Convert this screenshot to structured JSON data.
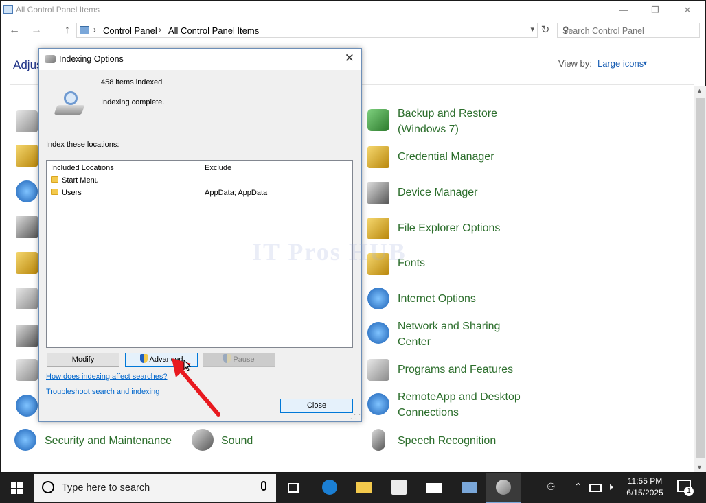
{
  "window": {
    "title": "All Control Panel Items",
    "minimize": "—",
    "maximize": "❐",
    "close": "✕",
    "nav": {
      "back": "←",
      "forward": "→",
      "up": "↑"
    },
    "breadcrumb": [
      "Control Panel",
      "All Control Panel Items"
    ],
    "breadcrumb_sep": "›",
    "search_placeholder": "Search Control Panel",
    "heading_partial": "Adjus",
    "view_by_label": "View by:",
    "view_by_value": "Large icons"
  },
  "items_right": [
    {
      "label": "Backup and Restore (Windows 7)",
      "icon": "backup-icon"
    },
    {
      "label": "Credential Manager",
      "icon": "credential-icon"
    },
    {
      "label": "Device Manager",
      "icon": "device-manager-icon"
    },
    {
      "label": "File Explorer Options",
      "icon": "folder-options-icon"
    },
    {
      "label": "Fonts",
      "icon": "fonts-icon"
    },
    {
      "label": "Internet Options",
      "icon": "globe-icon"
    },
    {
      "label": "Network and Sharing Center",
      "icon": "network-icon"
    },
    {
      "label": "Programs and Features",
      "icon": "programs-icon"
    },
    {
      "label": "RemoteApp and Desktop Connections",
      "icon": "remoteapp-icon"
    },
    {
      "label": "Speech Recognition",
      "icon": "microphone-icon"
    }
  ],
  "items_bottom": [
    {
      "label": "Security and Maintenance",
      "icon": "flag-icon"
    },
    {
      "label": "Sound",
      "icon": "speaker-icon"
    }
  ],
  "dialog": {
    "title": "Indexing Options",
    "items_indexed": "458 items indexed",
    "status": "Indexing complete.",
    "locations_label": "Index these locations:",
    "col_included": "Included Locations",
    "col_exclude": "Exclude",
    "rows": [
      {
        "location": "Start Menu",
        "exclude": ""
      },
      {
        "location": "Users",
        "exclude": "AppData; AppData"
      }
    ],
    "modify": "Modify",
    "advanced": "Advanced",
    "pause": "Pause",
    "link_affect": "How does indexing affect searches?",
    "link_troubleshoot": "Troubleshoot search and indexing",
    "close": "Close"
  },
  "watermark": "IT Pros HUB",
  "taskbar": {
    "search_placeholder": "Type here to search",
    "time": "11:55 PM",
    "date": "6/15/2025",
    "notification_count": "1"
  }
}
